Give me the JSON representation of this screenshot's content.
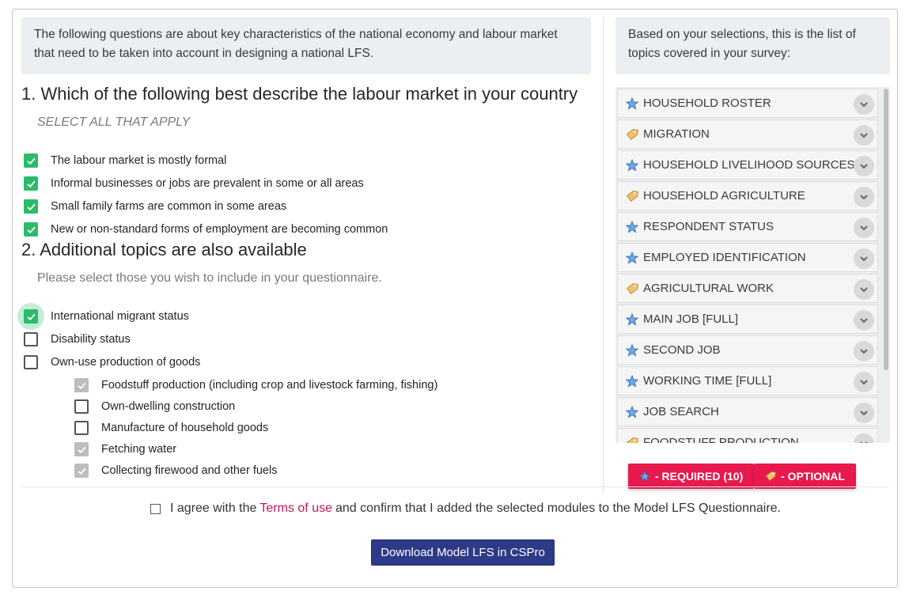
{
  "intro": "The following questions are about key characteristics of the national economy and labour market that need to be taken into account in designing a national LFS.",
  "q1": {
    "title": "1. Which of the following best describe the labour market in your country",
    "subtitle": "SELECT ALL THAT APPLY",
    "options": [
      {
        "label": "The labour market is mostly formal",
        "checked": true
      },
      {
        "label": "Informal businesses or jobs are prevalent in some or all areas",
        "checked": true
      },
      {
        "label": "Small family farms are common in some areas",
        "checked": true
      },
      {
        "label": "New or non-standard forms of employment are becoming common",
        "checked": true
      }
    ]
  },
  "q2": {
    "title": "2. Additional topics are also available",
    "subtitle": "Please select those you wish to include in your questionnaire.",
    "options": [
      {
        "label": "International migrant status",
        "checked": true
      },
      {
        "label": "Disability status",
        "checked": false
      },
      {
        "label": "Own-use production of goods",
        "checked": false
      }
    ],
    "suboptions": [
      {
        "label": "Foodstuff production (including crop and livestock farming, fishing)",
        "state": "disabled-checked"
      },
      {
        "label": "Own-dwelling construction",
        "state": "unchecked"
      },
      {
        "label": "Manufacture of household goods",
        "state": "unchecked"
      },
      {
        "label": "Fetching water",
        "state": "disabled-checked"
      },
      {
        "label": "Collecting firewood and other fuels",
        "state": "disabled-checked"
      }
    ]
  },
  "topics_intro": "Based on your selections, this is the list of topics covered in your survey:",
  "topics": [
    {
      "label": "HOUSEHOLD ROSTER",
      "icon": "star-icon"
    },
    {
      "label": "MIGRATION",
      "icon": "tag-icon"
    },
    {
      "label": "HOUSEHOLD LIVELIHOOD SOURCES",
      "icon": "star-icon"
    },
    {
      "label": "HOUSEHOLD AGRICULTURE",
      "icon": "tag-icon"
    },
    {
      "label": "RESPONDENT STATUS",
      "icon": "star-icon"
    },
    {
      "label": "EMPLOYED IDENTIFICATION",
      "icon": "star-icon"
    },
    {
      "label": "AGRICULTURAL WORK",
      "icon": "tag-icon"
    },
    {
      "label": "MAIN JOB [FULL]",
      "icon": "star-icon"
    },
    {
      "label": "SECOND JOB",
      "icon": "star-icon"
    },
    {
      "label": "WORKING TIME [FULL]",
      "icon": "star-icon"
    },
    {
      "label": "JOB SEARCH",
      "icon": "star-icon"
    },
    {
      "label": "FOODSTUFF PRODUCTION",
      "icon": "tag-icon"
    }
  ],
  "legend": {
    "required": "- REQUIRED (10)",
    "optional": "- OPTIONAL"
  },
  "agree": {
    "prefix": "I agree with the",
    "link": "Terms of use",
    "suffix": "and confirm that I added the selected modules to the Model LFS Questionnaire."
  },
  "download_label": "Download Model LFS in CSPro",
  "colors": {
    "checkbox_on": "#2bbb6b",
    "legend_bg": "#e8194f",
    "download_bg": "#2e3a87",
    "link": "#c2185b"
  }
}
